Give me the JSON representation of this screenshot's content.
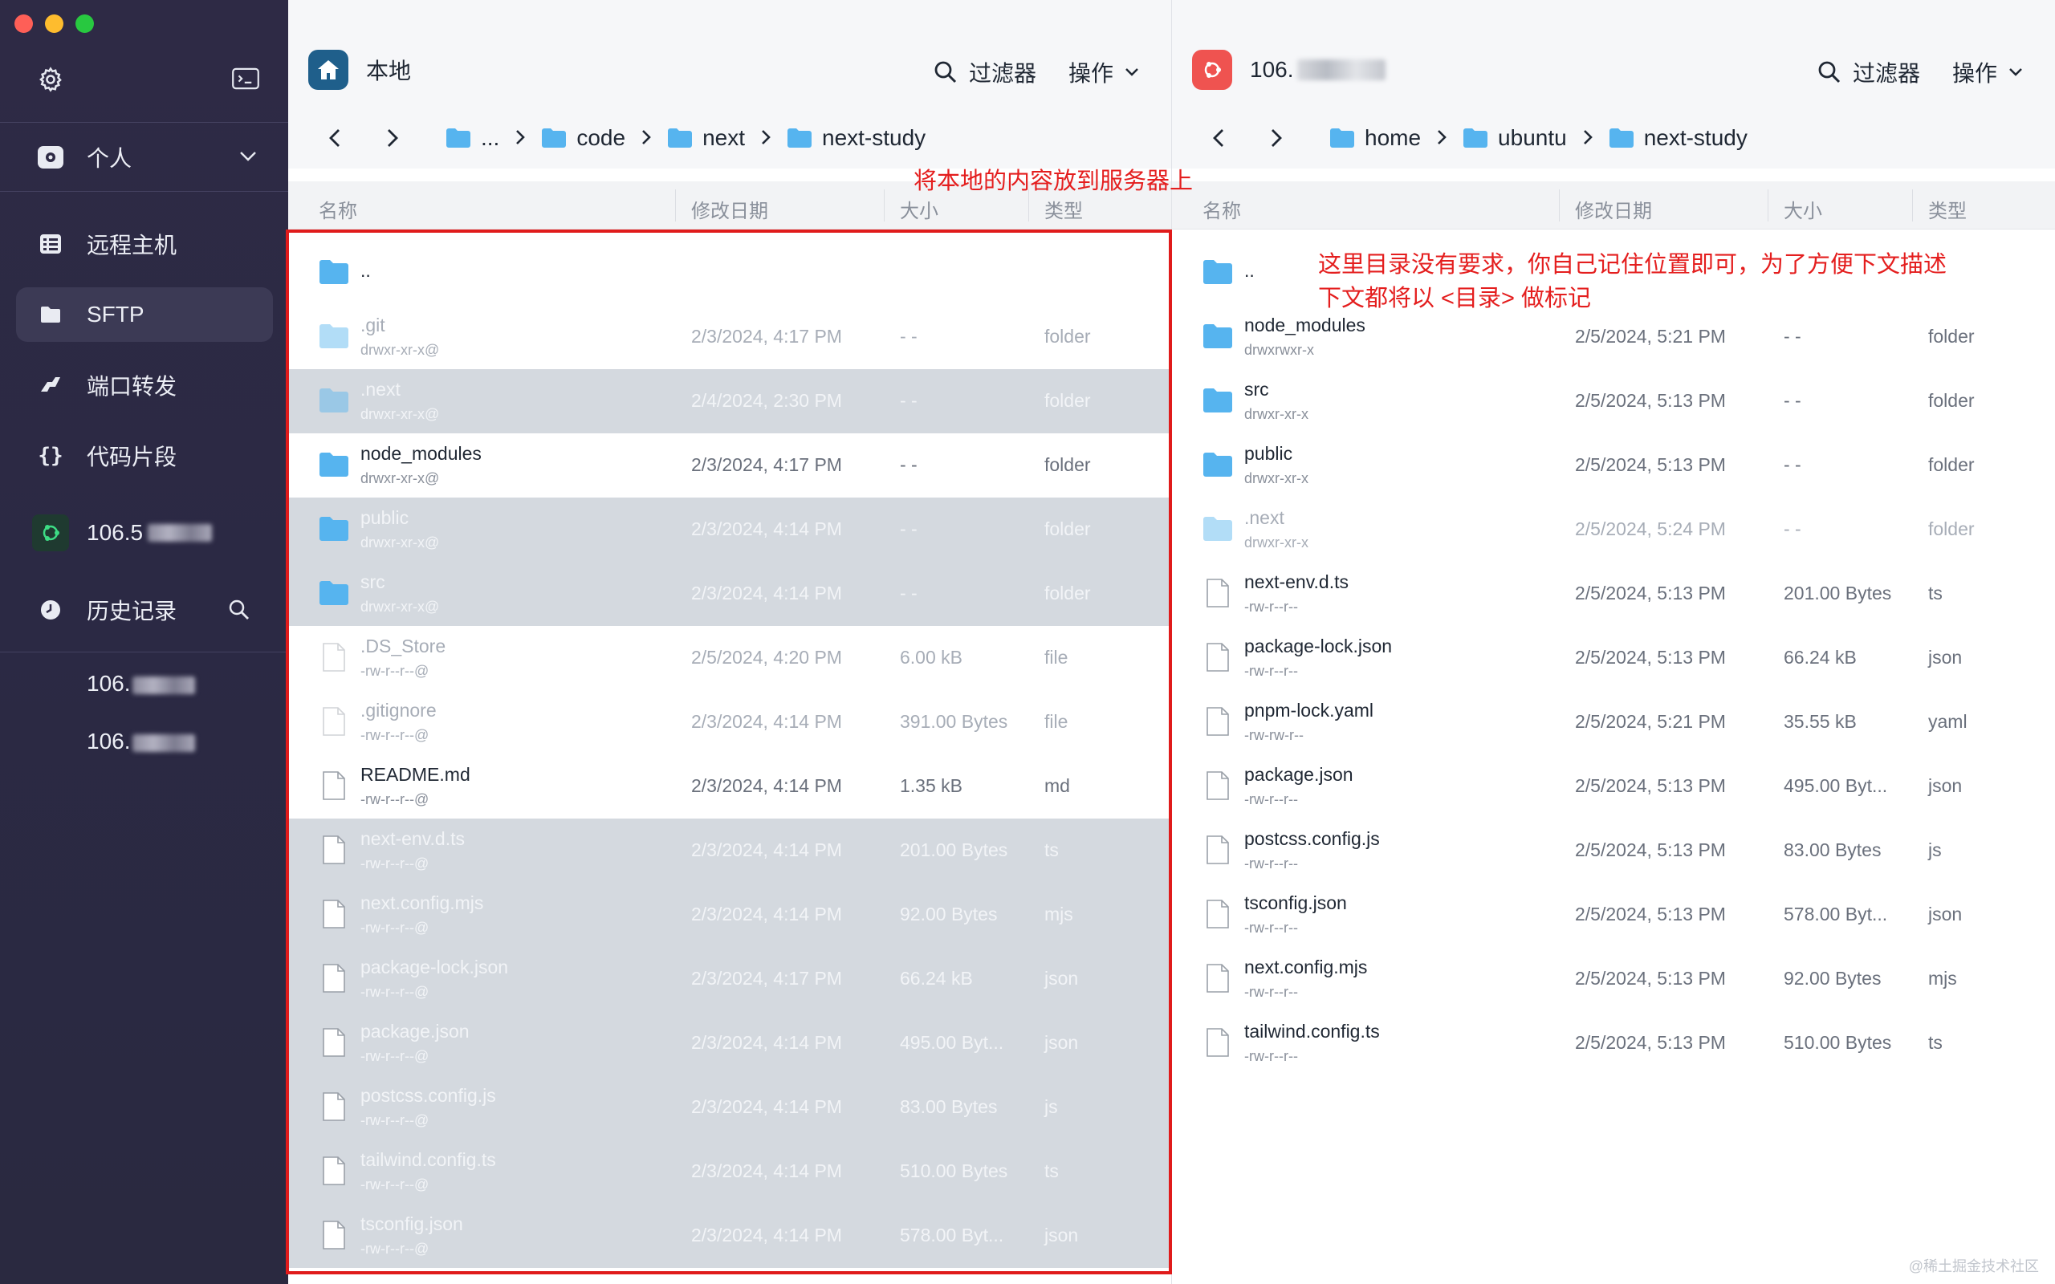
{
  "sidebar": {
    "profile_label": "个人",
    "nav": [
      {
        "label": "远程主机",
        "icon": "server-grid-icon"
      },
      {
        "label": "SFTP",
        "icon": "folder-icon"
      },
      {
        "label": "端口转发",
        "icon": "port-forward-icon"
      },
      {
        "label": "代码片段",
        "icon": "braces-icon"
      },
      {
        "label": "106.5",
        "icon": "ubuntu-icon"
      }
    ],
    "history_label": "历史记录",
    "history_items": [
      "106.",
      "106."
    ]
  },
  "local": {
    "title": "本地",
    "filter_label": "过滤器",
    "actions_label": "操作",
    "breadcrumbs": [
      "...",
      "code",
      "next",
      "next-study"
    ],
    "columns": {
      "name": "名称",
      "date": "修改日期",
      "size": "大小",
      "type": "类型"
    },
    "parent_label": "..",
    "files": [
      {
        "name": ".git",
        "perm": "drwxr-xr-x@",
        "date": "2/3/2024, 4:17 PM",
        "size": "- -",
        "type": "folder",
        "kind": "folder",
        "state": "dim"
      },
      {
        "name": ".next",
        "perm": "drwxr-xr-x@",
        "date": "2/4/2024, 2:30 PM",
        "size": "- -",
        "type": "folder",
        "kind": "folder",
        "state": "sel-dim"
      },
      {
        "name": "node_modules",
        "perm": "drwxr-xr-x@",
        "date": "2/3/2024, 4:17 PM",
        "size": "- -",
        "type": "folder",
        "kind": "folder",
        "state": "normal"
      },
      {
        "name": "public",
        "perm": "drwxr-xr-x@",
        "date": "2/3/2024, 4:14 PM",
        "size": "- -",
        "type": "folder",
        "kind": "folder",
        "state": "sel"
      },
      {
        "name": "src",
        "perm": "drwxr-xr-x@",
        "date": "2/3/2024, 4:14 PM",
        "size": "- -",
        "type": "folder",
        "kind": "folder",
        "state": "sel"
      },
      {
        "name": ".DS_Store",
        "perm": "-rw-r--r--@",
        "date": "2/5/2024, 4:20 PM",
        "size": "6.00 kB",
        "type": "file",
        "kind": "file",
        "state": "dim"
      },
      {
        "name": ".gitignore",
        "perm": "-rw-r--r--@",
        "date": "2/3/2024, 4:14 PM",
        "size": "391.00 Bytes",
        "type": "file",
        "kind": "file",
        "state": "dim"
      },
      {
        "name": "README.md",
        "perm": "-rw-r--r--@",
        "date": "2/3/2024, 4:14 PM",
        "size": "1.35 kB",
        "type": "md",
        "kind": "file",
        "state": "normal"
      },
      {
        "name": "next-env.d.ts",
        "perm": "-rw-r--r--@",
        "date": "2/3/2024, 4:14 PM",
        "size": "201.00 Bytes",
        "type": "ts",
        "kind": "file",
        "state": "sel"
      },
      {
        "name": "next.config.mjs",
        "perm": "-rw-r--r--@",
        "date": "2/3/2024, 4:14 PM",
        "size": "92.00 Bytes",
        "type": "mjs",
        "kind": "file",
        "state": "sel"
      },
      {
        "name": "package-lock.json",
        "perm": "-rw-r--r--@",
        "date": "2/3/2024, 4:17 PM",
        "size": "66.24 kB",
        "type": "json",
        "kind": "file",
        "state": "sel"
      },
      {
        "name": "package.json",
        "perm": "-rw-r--r--@",
        "date": "2/3/2024, 4:14 PM",
        "size": "495.00 Byt...",
        "type": "json",
        "kind": "file",
        "state": "sel"
      },
      {
        "name": "postcss.config.js",
        "perm": "-rw-r--r--@",
        "date": "2/3/2024, 4:14 PM",
        "size": "83.00 Bytes",
        "type": "js",
        "kind": "file",
        "state": "sel"
      },
      {
        "name": "tailwind.config.ts",
        "perm": "-rw-r--r--@",
        "date": "2/3/2024, 4:14 PM",
        "size": "510.00 Bytes",
        "type": "ts",
        "kind": "file",
        "state": "sel"
      },
      {
        "name": "tsconfig.json",
        "perm": "-rw-r--r--@",
        "date": "2/3/2024, 4:14 PM",
        "size": "578.00 Byt...",
        "type": "json",
        "kind": "file",
        "state": "sel"
      }
    ]
  },
  "remote": {
    "title": "106.",
    "filter_label": "过滤器",
    "actions_label": "操作",
    "breadcrumbs": [
      "home",
      "ubuntu",
      "next-study"
    ],
    "columns": {
      "name": "名称",
      "date": "修改日期",
      "size": "大小",
      "type": "类型"
    },
    "parent_label": "..",
    "files": [
      {
        "name": "node_modules",
        "perm": "drwxrwxr-x",
        "date": "2/5/2024, 5:21 PM",
        "size": "- -",
        "type": "folder",
        "kind": "folder",
        "state": "normal"
      },
      {
        "name": "src",
        "perm": "drwxr-xr-x",
        "date": "2/5/2024, 5:13 PM",
        "size": "- -",
        "type": "folder",
        "kind": "folder",
        "state": "normal"
      },
      {
        "name": "public",
        "perm": "drwxr-xr-x",
        "date": "2/5/2024, 5:13 PM",
        "size": "- -",
        "type": "folder",
        "kind": "folder",
        "state": "normal"
      },
      {
        "name": ".next",
        "perm": "drwxr-xr-x",
        "date": "2/5/2024, 5:24 PM",
        "size": "- -",
        "type": "folder",
        "kind": "folder",
        "state": "dim"
      },
      {
        "name": "next-env.d.ts",
        "perm": "-rw-r--r--",
        "date": "2/5/2024, 5:13 PM",
        "size": "201.00 Bytes",
        "type": "ts",
        "kind": "file",
        "state": "normal"
      },
      {
        "name": "package-lock.json",
        "perm": "-rw-r--r--",
        "date": "2/5/2024, 5:13 PM",
        "size": "66.24 kB",
        "type": "json",
        "kind": "file",
        "state": "normal"
      },
      {
        "name": "pnpm-lock.yaml",
        "perm": "-rw-rw-r--",
        "date": "2/5/2024, 5:21 PM",
        "size": "35.55 kB",
        "type": "yaml",
        "kind": "file",
        "state": "normal"
      },
      {
        "name": "package.json",
        "perm": "-rw-r--r--",
        "date": "2/5/2024, 5:13 PM",
        "size": "495.00 Byt...",
        "type": "json",
        "kind": "file",
        "state": "normal"
      },
      {
        "name": "postcss.config.js",
        "perm": "-rw-r--r--",
        "date": "2/5/2024, 5:13 PM",
        "size": "83.00 Bytes",
        "type": "js",
        "kind": "file",
        "state": "normal"
      },
      {
        "name": "tsconfig.json",
        "perm": "-rw-r--r--",
        "date": "2/5/2024, 5:13 PM",
        "size": "578.00 Byt...",
        "type": "json",
        "kind": "file",
        "state": "normal"
      },
      {
        "name": "next.config.mjs",
        "perm": "-rw-r--r--",
        "date": "2/5/2024, 5:13 PM",
        "size": "92.00 Bytes",
        "type": "mjs",
        "kind": "file",
        "state": "normal"
      },
      {
        "name": "tailwind.config.ts",
        "perm": "-rw-r--r--",
        "date": "2/5/2024, 5:13 PM",
        "size": "510.00 Bytes",
        "type": "ts",
        "kind": "file",
        "state": "normal"
      }
    ]
  },
  "annotations": {
    "left_note": "将本地的内容放到服务器上",
    "right_note_1": "这里目录没有要求，你自己记住位置即可，为了方便下文描述",
    "right_note_2": "下文都将以 <目录> 做标记"
  },
  "watermark": "@稀土掘金技术社区",
  "colors": {
    "sidebar_bg": "#2c2a44",
    "selection": "#d4d9df",
    "folder": "#56b4ef",
    "annotation_red": "#e41e1e",
    "ubuntu": "#e95420"
  }
}
